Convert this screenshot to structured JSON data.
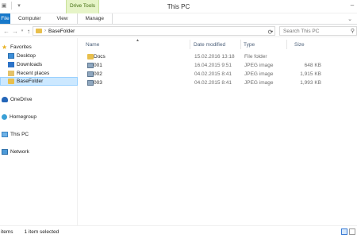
{
  "window": {
    "title": "This PC",
    "contextual_tab": "Drive Tools"
  },
  "ribbon": {
    "tabs": [
      "File",
      "Computer",
      "View",
      "Manage"
    ]
  },
  "address": {
    "path": "BaseFolder",
    "search_placeholder": "Search This PC"
  },
  "nav": {
    "favorites": "Favorites",
    "items": [
      "Desktop",
      "Downloads",
      "Recent places",
      "BaseFolder"
    ],
    "onedrive": "OneDrive",
    "homegroup": "Homegroup",
    "this_pc": "This PC",
    "network": "Network"
  },
  "columns": {
    "name": "Name",
    "date": "Date modified",
    "type": "Type",
    "size": "Size"
  },
  "files": [
    {
      "name": "Docs",
      "date": "15.02.2016 13:18",
      "type": "File folder",
      "size": "",
      "icon": "folder-icon"
    },
    {
      "name": "001",
      "date": "16.04.2015 9:51",
      "type": "JPEG image",
      "size": "648 KB",
      "icon": "image-icon"
    },
    {
      "name": "002",
      "date": "04.02.2015 8:41",
      "type": "JPEG image",
      "size": "1,915 KB",
      "icon": "image-icon"
    },
    {
      "name": "003",
      "date": "04.02.2015 8:41",
      "type": "JPEG image",
      "size": "1,993 KB",
      "icon": "image-icon"
    }
  ],
  "status": {
    "count": "items",
    "selection": "1 item selected"
  },
  "colors": {
    "file_tab": "#1979ca",
    "contextual_tab": "#e6f4c7",
    "selection": "#cce8ff",
    "folder": "#e8bf4c"
  }
}
